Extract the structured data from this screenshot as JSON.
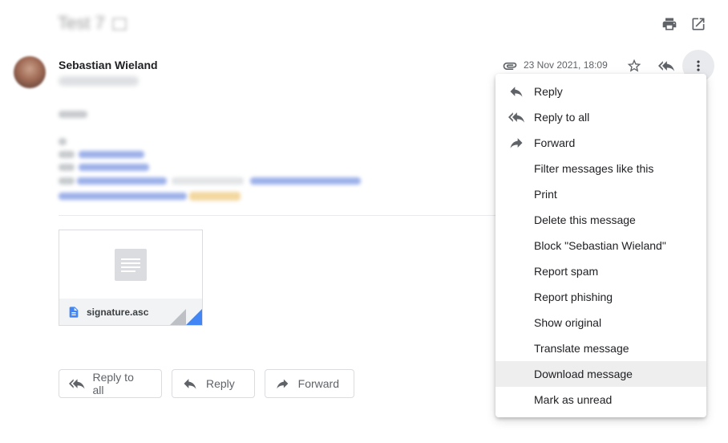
{
  "header": {
    "subject": "Test 7",
    "print_icon": "print-icon",
    "open_new_window_icon": "open-in-new-icon"
  },
  "message": {
    "sender_name": "Sebastian Wieland",
    "date": "23 Nov 2021, 18:09",
    "attachment": {
      "file_name": "signature.asc"
    }
  },
  "actions": {
    "reply_all_label": "Reply to all",
    "reply_label": "Reply",
    "forward_label": "Forward"
  },
  "menu": {
    "items": [
      {
        "label": "Reply",
        "icon": "reply-icon"
      },
      {
        "label": "Reply to all",
        "icon": "reply-all-icon"
      },
      {
        "label": "Forward",
        "icon": "forward-icon"
      },
      {
        "label": "Filter messages like this"
      },
      {
        "label": "Print"
      },
      {
        "label": "Delete this message"
      },
      {
        "label": "Block \"Sebastian Wieland\""
      },
      {
        "label": "Report spam"
      },
      {
        "label": "Report phishing"
      },
      {
        "label": "Show original"
      },
      {
        "label": "Translate message"
      },
      {
        "label": "Download message"
      },
      {
        "label": "Mark as unread"
      }
    ],
    "hovered_item": "Download message"
  },
  "colors": {
    "accent_blue": "#4285f4",
    "icon_gray": "#5f6368",
    "hover_bg": "#eeeeee"
  }
}
